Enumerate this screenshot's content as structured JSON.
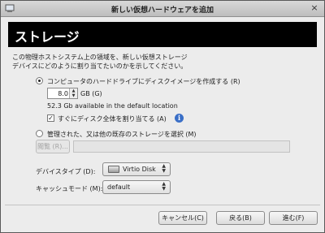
{
  "window": {
    "title": "新しい仮想ハードウェアを追加",
    "close_glyph": "×"
  },
  "banner": {
    "title": "ストレージ"
  },
  "description": {
    "line1": "この物理ホストシステム上の領域を、新しい仮想ストレージ",
    "line2": "デバイスにどのように割り当てたいのかを示してください。"
  },
  "option_create": {
    "label": "コンピュータのハードドライブにディスクイメージを作成する (R)",
    "selected": true,
    "size_value": "8.0",
    "size_unit_label": "GB (G)",
    "available_text": "52.3 Gb available in the default location",
    "allocate_label": "すぐにディスク全体を割り当てる (A)",
    "allocate_checked": true,
    "check_glyph": "✓",
    "info_glyph": "i"
  },
  "option_existing": {
    "label": "管理された、又は他の既存のストレージを選択 (M)",
    "selected": false,
    "browse_label": "閲覧 (R)...",
    "path_value": ""
  },
  "device_type": {
    "label": "デバイスタイプ (D):",
    "value": "Virtio Disk",
    "icon": "disk-icon"
  },
  "cache_mode": {
    "label": "キャッシュモード (M):",
    "value": "default"
  },
  "buttons": {
    "cancel": "キャンセル(C)",
    "back": "戻る(B)",
    "forward": "進む(F)"
  },
  "arrows": {
    "up": "▲",
    "down": "▼"
  }
}
